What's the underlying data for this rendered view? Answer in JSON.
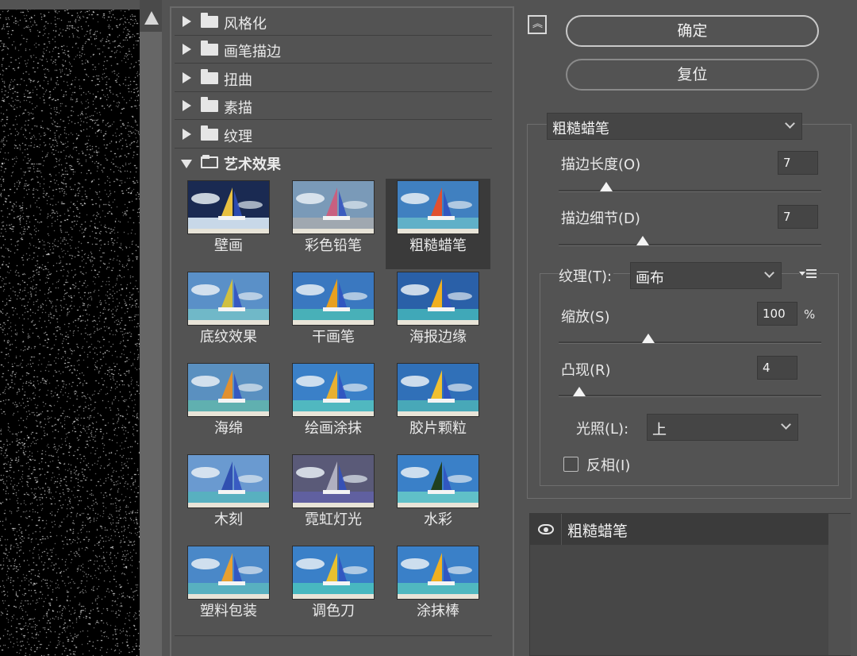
{
  "gallery": {
    "categories": [
      {
        "label": "风格化"
      },
      {
        "label": "画笔描边"
      },
      {
        "label": "扭曲"
      },
      {
        "label": "素描"
      },
      {
        "label": "纹理"
      },
      {
        "label": "艺术效果"
      }
    ],
    "filters": [
      {
        "label": "壁画",
        "sky": "#1a2a52",
        "sea": "#c8d8e8",
        "sail": "#e8c040",
        "selected": false
      },
      {
        "label": "彩色铅笔",
        "sky": "#7a9ab8",
        "sea": "#a0a8b0",
        "sail": "#c86080",
        "selected": false
      },
      {
        "label": "粗糙蜡笔",
        "sky": "#4080c0",
        "sea": "#60b0c8",
        "sail": "#e05030",
        "selected": true
      },
      {
        "label": "底纹效果",
        "sky": "#5a90c8",
        "sea": "#70b8c8",
        "sail": "#d0c040",
        "selected": false
      },
      {
        "label": "干画笔",
        "sky": "#3a78c0",
        "sea": "#48b0b8",
        "sail": "#e8a020",
        "selected": false
      },
      {
        "label": "海报边缘",
        "sky": "#2a60a8",
        "sea": "#40a8b8",
        "sail": "#f0b020",
        "selected": false
      },
      {
        "label": "海绵",
        "sky": "#5a90c0",
        "sea": "#60b0b0",
        "sail": "#e09030",
        "selected": false
      },
      {
        "label": "绘画涂抹",
        "sky": "#3a80c8",
        "sea": "#50b8c0",
        "sail": "#e8b030",
        "selected": false
      },
      {
        "label": "胶片颗粒",
        "sky": "#3070b8",
        "sea": "#48a8b8",
        "sail": "#f0c030",
        "selected": false
      },
      {
        "label": "木刻",
        "sky": "#6a9ad0",
        "sea": "#58b0c0",
        "sail": "#3050b0",
        "selected": false
      },
      {
        "label": "霓虹灯光",
        "sky": "#5a5a78",
        "sea": "#6060a0",
        "sail": "#b0b0c0",
        "selected": false
      },
      {
        "label": "水彩",
        "sky": "#3a80c8",
        "sea": "#60c0c8",
        "sail": "#204020",
        "selected": false
      },
      {
        "label": "塑料包装",
        "sky": "#4a88c8",
        "sea": "#58b0c0",
        "sail": "#e8a030",
        "selected": false
      },
      {
        "label": "调色刀",
        "sky": "#3a80c8",
        "sea": "#48b8c0",
        "sail": "#e8c030",
        "selected": false
      },
      {
        "label": "涂抹棒",
        "sky": "#3a80c8",
        "sea": "#50b8c0",
        "sail": "#f0b020",
        "selected": false
      }
    ]
  },
  "buttons": {
    "ok": "确定",
    "reset": "复位"
  },
  "settings": {
    "filter_select": "粗糙蜡笔",
    "stroke_length": {
      "label": "描边长度(O)",
      "value": "7",
      "fraction": 0.18
    },
    "stroke_detail": {
      "label": "描边细节(D)",
      "value": "7",
      "fraction": 0.32
    },
    "texture": {
      "label": "纹理(T):",
      "value": "画布"
    },
    "scaling": {
      "label": "缩放(S)",
      "value": "100",
      "unit": "%",
      "fraction": 0.34
    },
    "relief": {
      "label": "凸现(R)",
      "value": "4",
      "fraction": 0.08
    },
    "light": {
      "label": "光照(L):",
      "value": "上"
    },
    "invert": {
      "label": "反相(I)",
      "checked": false
    }
  },
  "layers": {
    "name": "粗糙蜡笔"
  }
}
